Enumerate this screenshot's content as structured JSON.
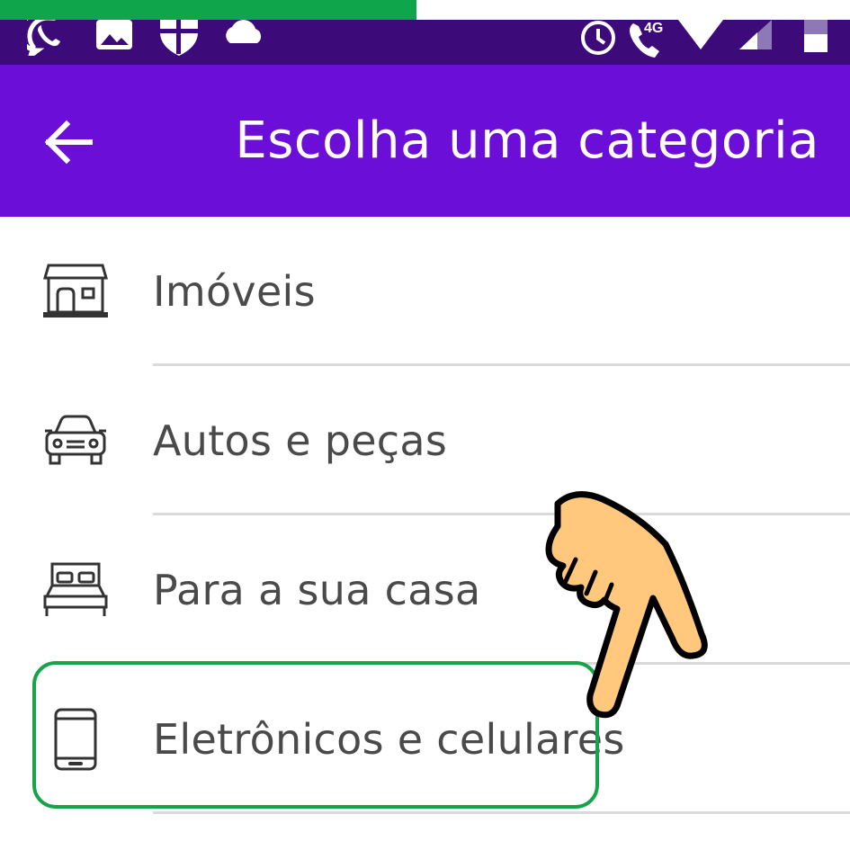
{
  "progress": {
    "fraction": 0.49,
    "color": "#0fa54a"
  },
  "status_bar": {
    "background": "#3d0a7a",
    "left_icons": [
      "whatsapp-icon",
      "image-icon",
      "shield-icon",
      "cloud-icon"
    ],
    "right_icons": [
      "alarm-icon",
      "call-4g-icon",
      "wifi-icon",
      "signal-icon",
      "battery-icon"
    ],
    "network_label": "4G"
  },
  "app_bar": {
    "background": "#6b0fd8",
    "back_icon": "arrow-back-icon",
    "title": "Escolha uma categoria"
  },
  "categories": [
    {
      "label": "Imóveis",
      "icon": "house-icon"
    },
    {
      "label": "Autos e peças",
      "icon": "car-icon"
    },
    {
      "label": "Para a sua casa",
      "icon": "bed-icon"
    },
    {
      "label": "Eletrônicos e celulares",
      "icon": "phone-icon"
    }
  ],
  "highlight": {
    "item": "Eletrônicos e celulares",
    "color": "#17a34a"
  },
  "pointer": {
    "icon": "pointing-hand-icon",
    "color": "#ffc87c"
  }
}
